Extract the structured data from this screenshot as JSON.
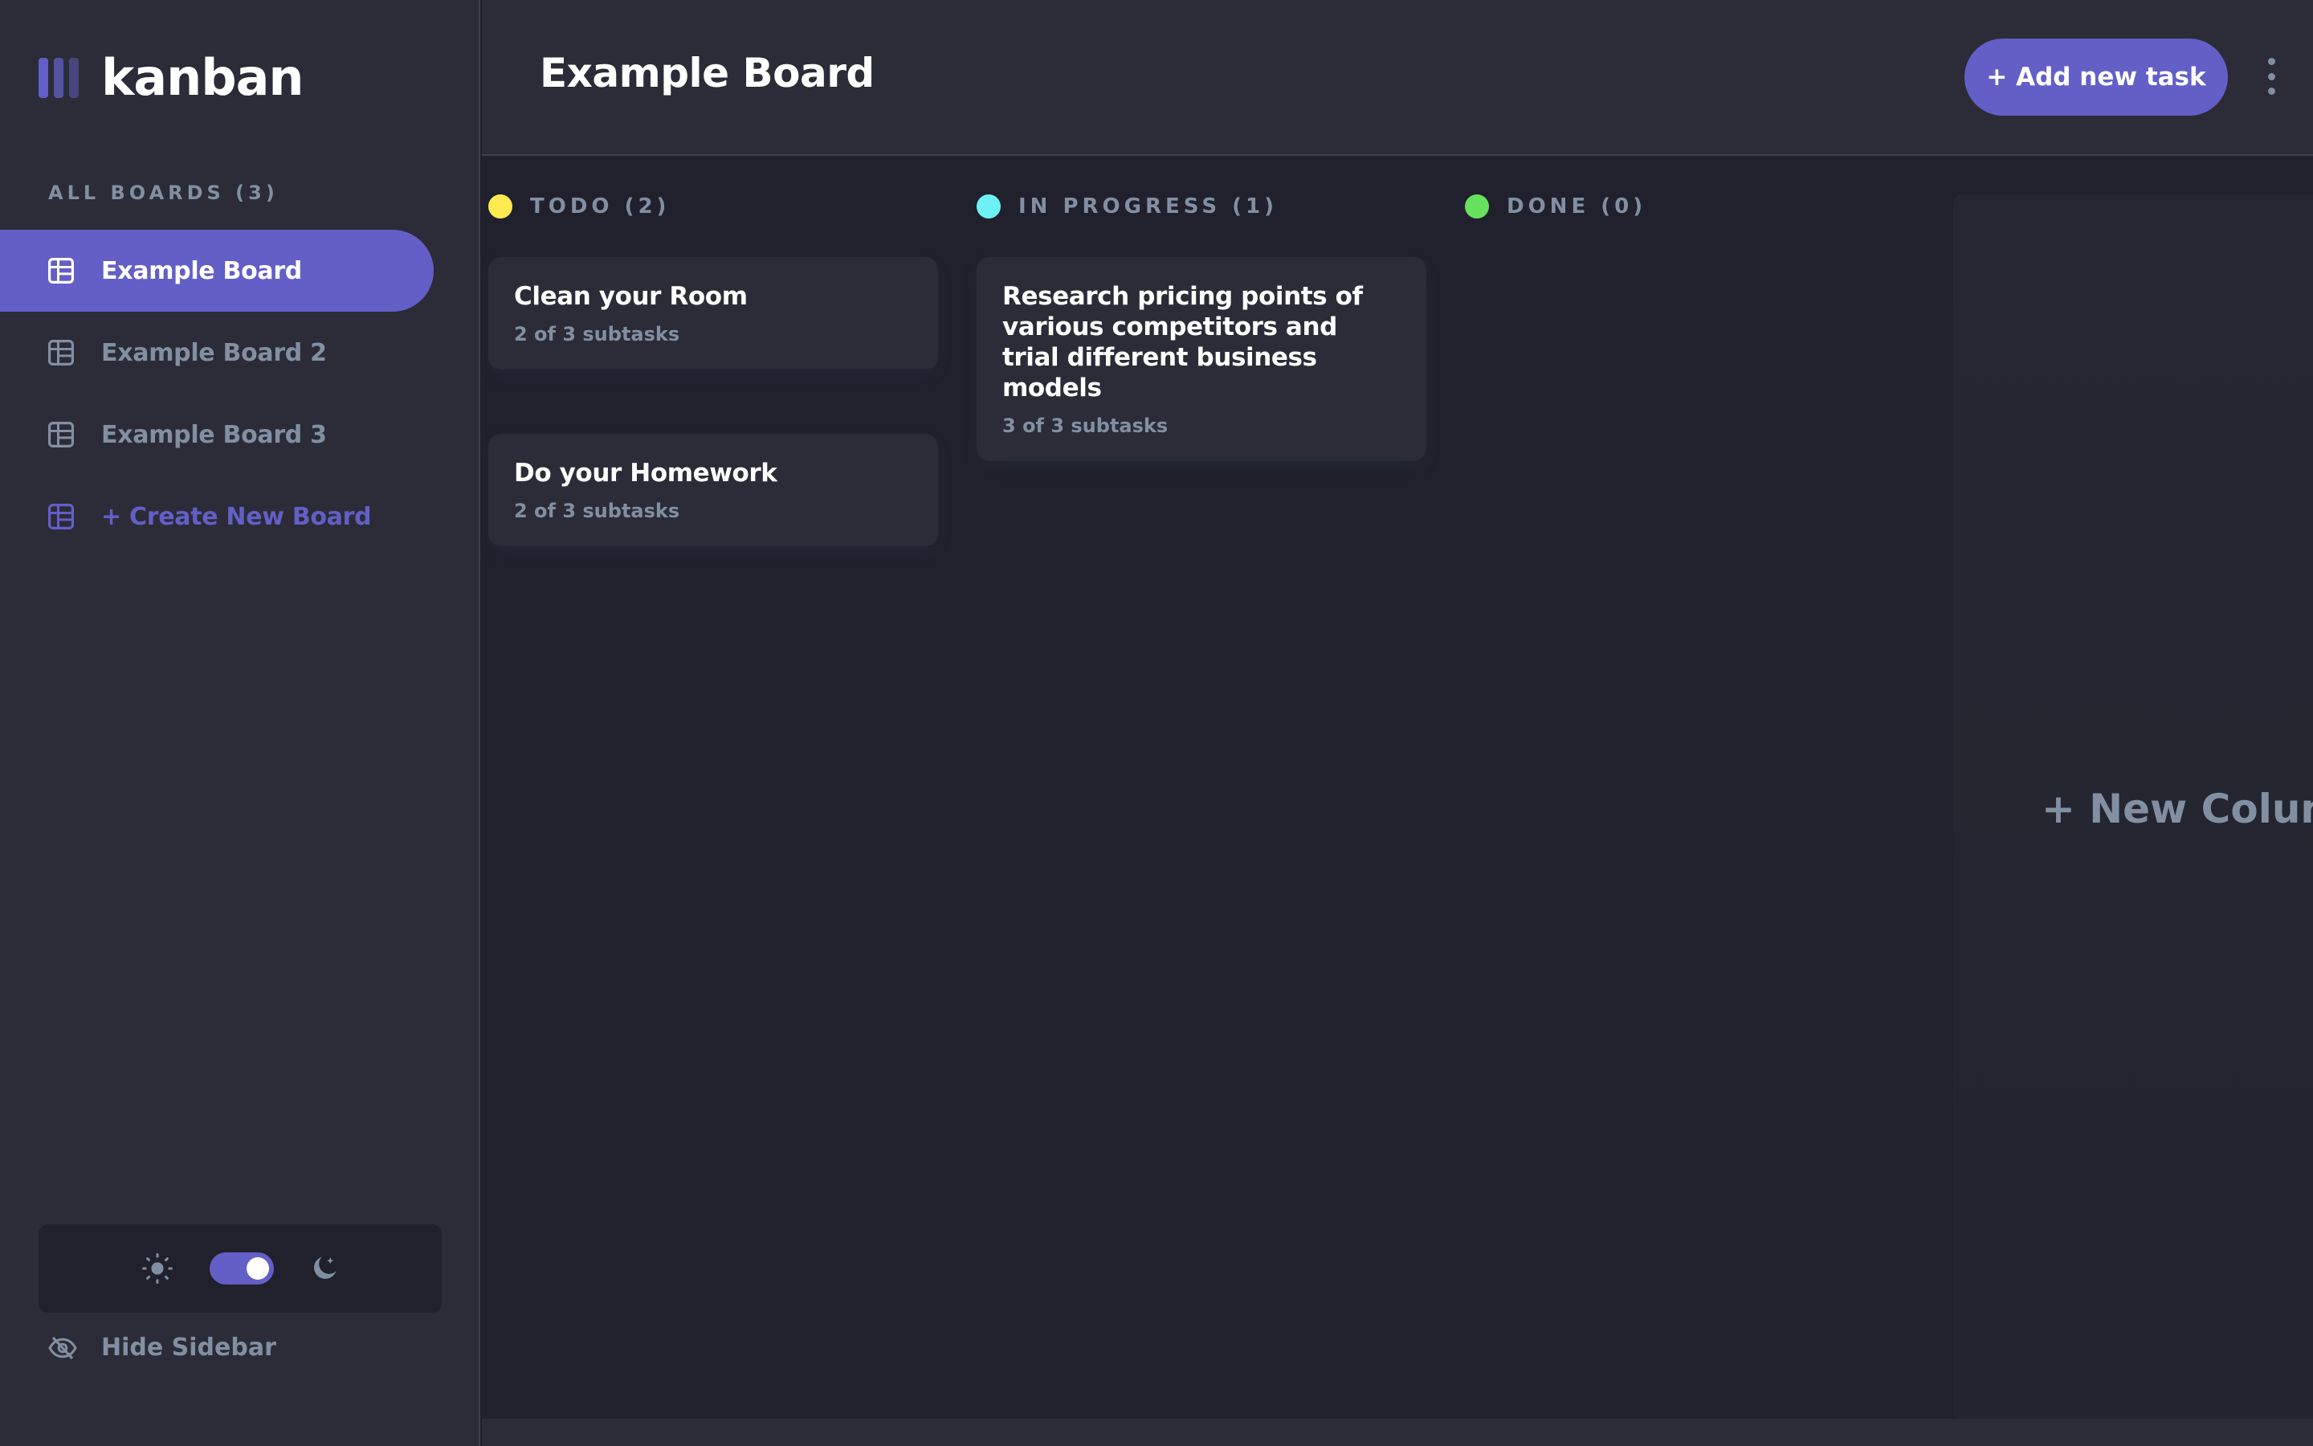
{
  "app": {
    "logo_text": "kanban"
  },
  "sidebar": {
    "boards_heading": "ALL BOARDS (3)",
    "boards": [
      {
        "label": "Example Board",
        "active": true
      },
      {
        "label": "Example Board 2",
        "active": false
      },
      {
        "label": "Example Board 3",
        "active": false
      }
    ],
    "create_label": "+ Create New Board",
    "theme": {
      "mode": "dark",
      "light_icon": "sun-icon",
      "dark_icon": "moon-icon"
    },
    "hide_label": "Hide Sidebar"
  },
  "header": {
    "title": "Example Board",
    "add_task_label": "+ Add new task",
    "menu_icon": "vertical-ellipsis-icon"
  },
  "columns": [
    {
      "name": "TODO (2)",
      "color": "#ffea4f",
      "tasks": [
        {
          "title": "Clean your Room",
          "subtasks": "2 of 3 subtasks"
        },
        {
          "title": "Do your Homework",
          "subtasks": "2 of 3 subtasks"
        }
      ]
    },
    {
      "name": "IN PROGRESS (1)",
      "color": "#6ef1f5",
      "tasks": [
        {
          "title": "Research pricing points of various competitors and trial different business models",
          "subtasks": "3 of 3 subtasks"
        }
      ]
    },
    {
      "name": "DONE (0)",
      "color": "#67e25f",
      "tasks": []
    }
  ],
  "new_column_label": "+ New Column",
  "colors": {
    "accent": "#635fc7",
    "background": "#20212c",
    "surface": "#2b2c37",
    "muted_text": "#828fa3"
  }
}
